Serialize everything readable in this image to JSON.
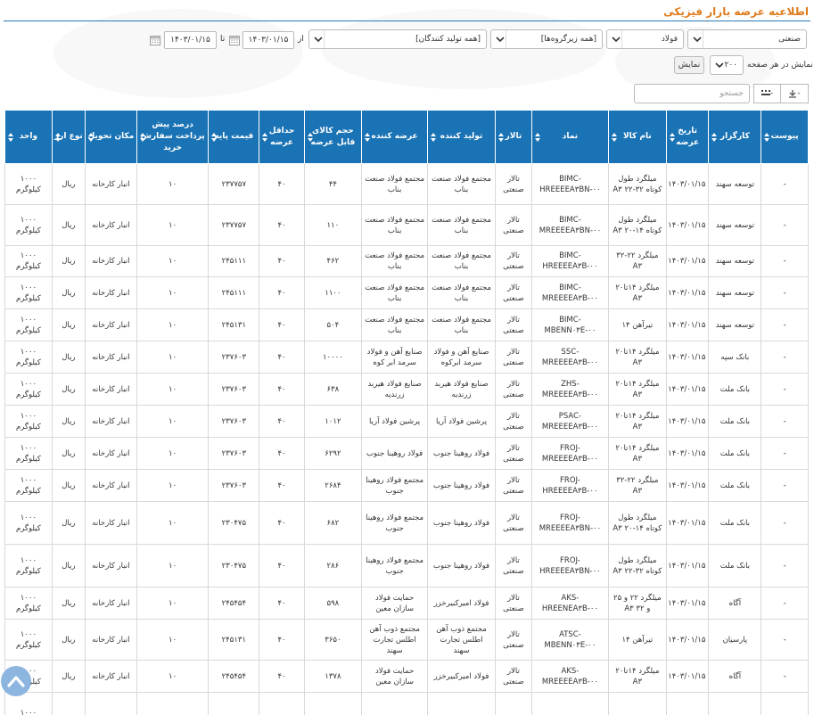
{
  "title": "اطلاعیه عرضه بازار فیزیکی",
  "filters": {
    "market": "صنعتی",
    "group": "فولاد",
    "subgroup": "[همه زیرگروه‌ها]",
    "producer": "[همه تولید کنندگان]",
    "from_label": "از",
    "to_label": "تا",
    "date_from": "۱۴۰۳/۰۱/۱۵",
    "date_to": "۱۴۰۳/۰۱/۱۵",
    "page_size_label": "نمایش در هر صفحه",
    "page_size": "۲۰۰",
    "show_button": "نمایش",
    "search_placeholder": "جستجو",
    "toolbar_minus": "-",
    "toolbar_grid_minus": "-"
  },
  "table": {
    "headers": [
      "پیوست",
      "کارگزار",
      "تاریخ عرضه",
      "نام کالا",
      "نماد",
      "تالار",
      "تولید کننده",
      "عرضه کننده",
      "حجم کالای قابل عرضه",
      "حداقل عرضه",
      "قیمت پایه",
      "درصد پیش پرداخت سفارش خرید",
      "مکان تحویل",
      "نوع ارز",
      "واحد"
    ],
    "rows": [
      {
        "h": "r1",
        "c": [
          "-",
          "توسعه سهند",
          "۱۴۰۳/۰۱/۱۵",
          "میلگرد طول کوتاه ۳۲-۲۲ A۳",
          "BIMC-HREEEEA۳BN-۰۰",
          "تالار صنعتی",
          "مجتمع فولاد صنعت بناب",
          "مجتمع فولاد صنعت بناب",
          "۴۴",
          "۴۰",
          "۲۳۷۷۵۷",
          "۱۰",
          "انبار کارخانه",
          "ریال",
          "۱۰۰۰ کیلوگرم"
        ]
      },
      {
        "h": "r1",
        "c": [
          "-",
          "توسعه سهند",
          "۱۴۰۳/۰۱/۱۵",
          "میلگرد طول کوتاه ۱۴-۲۰ A۳",
          "BIMC-MREEEEA۳BN-۰۰",
          "تالار صنعتی",
          "مجتمع فولاد صنعت بناب",
          "مجتمع فولاد صنعت بناب",
          "۱۱۰",
          "۴۰",
          "۲۳۷۷۵۷",
          "۱۰",
          "انبار کارخانه",
          "ریال",
          "۱۰۰۰ کیلوگرم"
        ]
      },
      {
        "h": "r2",
        "c": [
          "-",
          "توسعه سهند",
          "۱۴۰۳/۰۱/۱۵",
          "میلگرد ۲۲-۳۲ A۳",
          "BIMC-HREEEEA۳B-۰۰",
          "تالار صنعتی",
          "مجتمع فولاد صنعت بناب",
          "مجتمع فولاد صنعت بناب",
          "۴۶۲",
          "۴۰",
          "۲۴۵۱۱۱",
          "۱۰",
          "انبار کارخانه",
          "ریال",
          "۱۰۰۰ کیلوگرم"
        ]
      },
      {
        "h": "r3",
        "c": [
          "-",
          "توسعه سهند",
          "۱۴۰۳/۰۱/۱۵",
          "میلگرد ۱۴تا۲۰ A۳",
          "BIMC-MREEEEA۳B-۰۰",
          "تالار صنعتی",
          "مجتمع فولاد صنعت بناب",
          "مجتمع فولاد صنعت بناب",
          "۱۱۰۰",
          "۴۰",
          "۲۴۵۱۱۱",
          "۱۰",
          "انبار کارخانه",
          "ریال",
          "۱۰۰۰ کیلوگرم"
        ]
      },
      {
        "h": "r3",
        "c": [
          "-",
          "توسعه سهند",
          "۱۴۰۳/۰۱/۱۵",
          "تیرآهن ۱۴",
          "BIMC-MBENN۰۳E-۰۰",
          "تالار صنعتی",
          "مجتمع فولاد صنعت بناب",
          "مجتمع فولاد صنعت بناب",
          "۵۰۴",
          "۴۰",
          "۲۴۵۱۳۱",
          "۱۰",
          "انبار کارخانه",
          "ریال",
          "۱۰۰۰ کیلوگرم"
        ]
      },
      {
        "h": "r3",
        "c": [
          "-",
          "بانک سپه",
          "۱۴۰۳/۰۱/۱۵",
          "میلگرد ۱۴تا۲۰ A۳",
          "SSC-MREEEEA۳B-۰۰",
          "تالار صنعتی",
          "صنایع آهن و فولاد سرمد ابرکوه",
          "صنایع آهن و فولاد سرمد ابر کوه",
          "۱۰۰۰۰",
          "۴۰",
          "۲۳۷۶۰۳",
          "۱۰",
          "انبار کارخانه",
          "ریال",
          "۱۰۰۰ کیلوگرم"
        ]
      },
      {
        "h": "r3",
        "c": [
          "-",
          "بانک ملت",
          "۱۴۰۳/۰۱/۱۵",
          "میلگرد ۱۴تا۲۰ A۳",
          "ZHS-MREEEEA۳B-۰۰",
          "تالار صنعتی",
          "صنایع فولاد هیربد زرندیه",
          "صنایع فولاد هیربد زرندیه",
          "۶۳۸",
          "۴۰",
          "۲۳۷۶۰۳",
          "۱۰",
          "انبار کارخانه",
          "ریال",
          "۱۰۰۰ کیلوگرم"
        ]
      },
      {
        "h": "r3",
        "c": [
          "-",
          "بانک ملت",
          "۱۴۰۳/۰۱/۱۵",
          "میلگرد ۱۴تا۲۰ A۳",
          "PSAC-MREEEEA۳B-۰۰",
          "تالار صنعتی",
          "پرشین فولاد آریا",
          "پرشین فولاد آریا",
          "۱۰۱۲",
          "۴۰",
          "۲۳۷۶۰۳",
          "۱۰",
          "انبار کارخانه",
          "ریال",
          "۱۰۰۰ کیلوگرم"
        ]
      },
      {
        "h": "r3",
        "c": [
          "-",
          "بانک ملت",
          "۱۴۰۳/۰۱/۱۵",
          "میلگرد ۱۴تا۲۰ A۳",
          "FROJ-MREEEEA۳B-۰۰",
          "تالار صنعتی",
          "فولاد روهینا جنوب",
          "فولاد روهینا جنوب",
          "۶۲۹۲",
          "۴۰",
          "۲۳۷۶۰۳",
          "۱۰",
          "انبار کارخانه",
          "ریال",
          "۱۰۰۰ کیلوگرم"
        ]
      },
      {
        "h": "r3",
        "c": [
          "-",
          "بانک ملت",
          "۱۴۰۳/۰۱/۱۵",
          "میلگرد ۲۲-۳۲ A۳",
          "FROJ-HREEEEA۳B-۰۰",
          "تالار صنعتی",
          "فولاد روهینا جنوب",
          "مجتمع فولاد روهینا جنوب",
          "۲۶۸۴",
          "۴۰",
          "۲۳۷۶۰۳",
          "۱۰",
          "انبار کارخانه",
          "ریال",
          "۱۰۰۰ کیلوگرم"
        ]
      },
      {
        "h": "r4",
        "c": [
          "-",
          "بانک ملت",
          "۱۴۰۳/۰۱/۱۵",
          "میلگرد طول کوتاه ۱۴-۲۰ A۳",
          "FROJ-MREEEEA۳BN-۰۰",
          "تالار صنعتی",
          "فولاد روهینا جنوب",
          "مجتمع فولاد روهینا جنوب",
          "۶۸۲",
          "۴۰",
          "۲۳۰۴۷۵",
          "۱۰",
          "انبار کارخانه",
          "ریال",
          "۱۰۰۰ کیلوگرم"
        ]
      },
      {
        "h": "r4",
        "c": [
          "-",
          "بانک ملت",
          "۱۴۰۳/۰۱/۱۵",
          "میلگرد طول کوتاه ۳۲-۲۲ A۳",
          "FROJ-HREEEEA۳BN-۰۰",
          "تالار صنعتی",
          "فولاد روهینا جنوب",
          "مجتمع فولاد روهینا جنوب",
          "۲۸۶",
          "۴۰",
          "۲۳۰۴۷۵",
          "۱۰",
          "انبار کارخانه",
          "ریال",
          "۱۰۰۰ کیلوگرم"
        ]
      },
      {
        "h": "r3",
        "c": [
          "-",
          "آگاه",
          "۱۴۰۳/۰۱/۱۵",
          "میلگرد ۲۲ و ۲۵ و ۳۲ A۳",
          "AKS-HREENEA۳B-۰۰",
          "تالار صنعتی",
          "فولاد امیرکبیرخزر",
          "حمایت فولاد سازان معین",
          "۵۹۸",
          "۴۰",
          "۲۴۵۴۵۴",
          "۱۰",
          "انبار کارخانه",
          "ریال",
          "۱۰۰۰ کیلوگرم"
        ]
      },
      {
        "h": "r1",
        "c": [
          "-",
          "پارسیان",
          "۱۴۰۳/۰۱/۱۵",
          "تیرآهن ۱۴",
          "ATSC-MBENN۰۳E-۰۰",
          "تالار صنعتی",
          "مجتمع ذوب آهن اطلس تجارت سهند",
          "مجتمع ذوب آهن اطلس تجارت سهند",
          "۳۶۵۰",
          "۴۰",
          "۲۴۵۱۳۱",
          "۱۰",
          "انبار کارخانه",
          "ریال",
          "۱۰۰۰ کیلوگرم"
        ]
      },
      {
        "h": "r3",
        "c": [
          "-",
          "آگاه",
          "۱۴۰۳/۰۱/۱۵",
          "میلگرد ۱۴تا۲۰ A۳",
          "AKS-MREEEEA۳B-۰۰",
          "تالار صنعتی",
          "فولاد امیرکبیرخزر",
          "حمایت فولاد سازان معین",
          "۱۳۷۸",
          "۴۰",
          "۲۴۵۴۵۴",
          "۱۰",
          "انبار کارخانه",
          "ریال",
          "۱۰۰۰ کیلوگرم"
        ]
      },
      {
        "h": "r1",
        "c": [
          "",
          "",
          "",
          "",
          "",
          "",
          "",
          "",
          "",
          "",
          "",
          "",
          "",
          "",
          "۱۰۰۰"
        ]
      }
    ]
  },
  "icons": {
    "dropdown": "chevron-down-icon",
    "calendar": "calendar-icon",
    "sort": "sort-icon",
    "scroll_top": "chevron-up-icon",
    "export": "export-icon",
    "columns": "columns-icon"
  },
  "colors": {
    "title": "#e07b1c",
    "header_bg": "#1a73b5",
    "scroll_btn": "#8cb6df"
  }
}
